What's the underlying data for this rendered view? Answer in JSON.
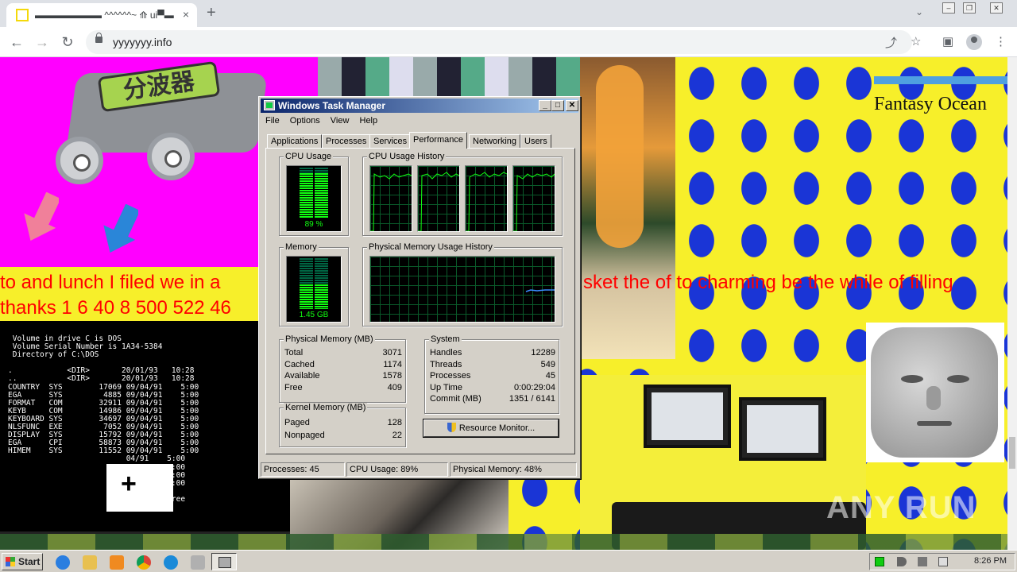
{
  "browser": {
    "tab_title": "▬▬▬▬▬▬▬ ^^^^^^~ ⟰ ui▀▬",
    "tab_close_icon": "×",
    "new_tab_icon": "+",
    "url": "yyyyyyy.info"
  },
  "page": {
    "splitter_label": "分波器",
    "banner_text_left_1": "to and lunch I filed we in a",
    "banner_text_left_2": "thanks 1 6 40 8 500 522 46",
    "banner_text_right": "sket the of to charming be the while of filling",
    "fantasy_text": "Fantasy Ocean",
    "dos_listing": " Volume in drive C is DOS\n Volume Serial Number is 1A34-5384\n Directory of C:\\DOS\n\n.            <DIR>       20/01/93   10:28\n..           <DIR>       20/01/93   10:28\nCOUNTRY  SYS        17069 09/04/91    5:00\nEGA      SYS         4885 09/04/91    5:00\nFORMAT   COM        32911 09/04/91    5:00\nKEYB     COM        14986 09/04/91    5:00\nKEYBOARD SYS        34697 09/04/91    5:00\nNLSFUNC  EXE         7052 09/04/91    5:00\nDISPLAY  SYS        15792 09/04/91    5:00\nEGA      CPI        58873 09/04/91    5:00\nHIMEM    SYS        11552 09/04/91    5:00\n                          04/91    5:00\n                          04/91    5:00\n                          04/91    5:00\n                          04/91    5:00\n                          66 bytes\n                          72 bytes free",
    "watermark": "ANY RUN"
  },
  "task_manager": {
    "title": "Windows Task Manager",
    "menu": [
      "File",
      "Options",
      "View",
      "Help"
    ],
    "tabs": [
      "Applications",
      "Processes",
      "Services",
      "Performance",
      "Networking",
      "Users"
    ],
    "active_tab": "Performance",
    "cpu_usage_label": "CPU Usage",
    "cpu_usage_value": "89 %",
    "cpu_usage_fraction": 0.89,
    "cpu_history_label": "CPU Usage History",
    "memory_label": "Memory",
    "memory_value": "1.45 GB",
    "memory_fraction": 0.48,
    "mem_history_label": "Physical Memory Usage History",
    "physical_memory": {
      "label": "Physical Memory (MB)",
      "rows": [
        {
          "k": "Total",
          "v": "3071"
        },
        {
          "k": "Cached",
          "v": "1174"
        },
        {
          "k": "Available",
          "v": "1578"
        },
        {
          "k": "Free",
          "v": "409"
        }
      ]
    },
    "system": {
      "label": "System",
      "rows": [
        {
          "k": "Handles",
          "v": "12289"
        },
        {
          "k": "Threads",
          "v": "549"
        },
        {
          "k": "Processes",
          "v": "45"
        },
        {
          "k": "Up Time",
          "v": "0:00:29:04"
        },
        {
          "k": "Commit (MB)",
          "v": "1351 / 6141"
        }
      ]
    },
    "kernel_memory": {
      "label": "Kernel Memory (MB)",
      "rows": [
        {
          "k": "Paged",
          "v": "128"
        },
        {
          "k": "Nonpaged",
          "v": "22"
        }
      ]
    },
    "resource_monitor_button": "Resource Monitor...",
    "status": {
      "processes": "Processes: 45",
      "cpu": "CPU Usage: 89%",
      "memory": "Physical Memory: 48%"
    }
  },
  "taskbar": {
    "start_label": "Start",
    "clock": "8:26 PM"
  },
  "colors": {
    "titlebar_start": "#0a246a",
    "titlebar_end": "#a6caf0",
    "graph_green": "#11ff11",
    "page_yellow": "#f7ef2a",
    "page_blue": "#1a35d6",
    "page_magenta": "#ff00ff",
    "banner_red": "#ff0000"
  },
  "icons": {
    "tab_favicon": "yellow-square-icon",
    "back": "arrow-left-icon",
    "forward": "arrow-right-icon",
    "reload": "reload-icon",
    "share": "share-icon",
    "bookmark": "star-icon",
    "sidepanel": "side-panel-icon",
    "profile": "profile-icon",
    "menu": "kebab-menu-icon"
  }
}
